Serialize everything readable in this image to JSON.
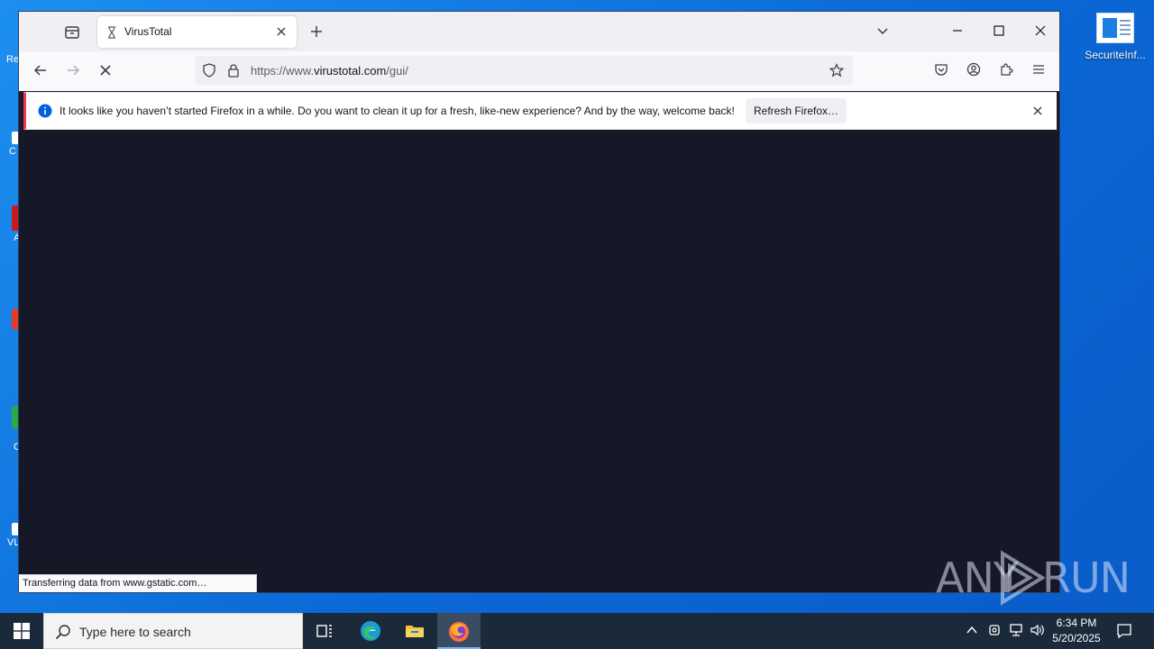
{
  "desktop": {
    "left_icon_labels": [
      "Re",
      "C",
      "A",
      "",
      "C",
      "VL"
    ],
    "right_icon_label": "SecuriteInf..."
  },
  "browser": {
    "tab_title": "VirusTotal",
    "url_prefix": "https://www.",
    "url_domain": "virustotal.com",
    "url_path": "/gui/",
    "notification_message": "It looks like you haven’t started Firefox in a while. Do you want to clean it up for a fresh, like-new experience? And by the way, welcome back!",
    "refresh_button_label": "Refresh Firefox…",
    "status_text": "Transferring data from www.gstatic.com…",
    "notification_accent": "#e8395a",
    "content_background": "#171827"
  },
  "watermark": {
    "left": "ANY",
    "right": "RUN"
  },
  "taskbar": {
    "search_placeholder": "Type here to search",
    "time": "6:34 PM",
    "date": "5/20/2025",
    "apps": [
      "task-view",
      "edge",
      "file-explorer",
      "firefox"
    ],
    "active_app": "firefox"
  }
}
